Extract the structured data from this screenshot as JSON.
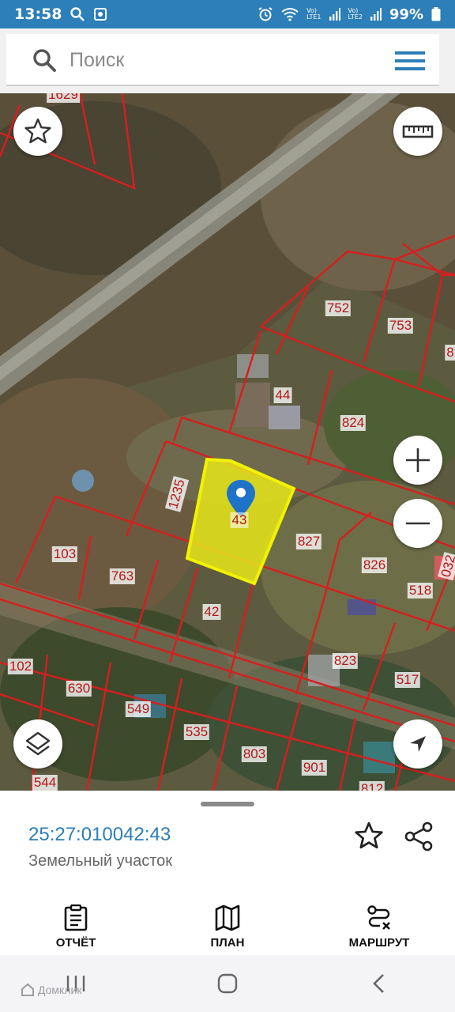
{
  "status_bar": {
    "time": "13:58",
    "network1": "Vo)\nLTE1",
    "network2": "Vo)\nLTE2",
    "battery": "99%"
  },
  "search": {
    "placeholder": "Поиск"
  },
  "map": {
    "parcels": [
      {
        "label": "1629"
      },
      {
        "label": "752"
      },
      {
        "label": "753"
      },
      {
        "label": "8"
      },
      {
        "label": "44"
      },
      {
        "label": "824"
      },
      {
        "label": "1235"
      },
      {
        "label": "43"
      },
      {
        "label": "827"
      },
      {
        "label": "103"
      },
      {
        "label": "763"
      },
      {
        "label": "826"
      },
      {
        "label": "518"
      },
      {
        "label": "42"
      },
      {
        "label": "102"
      },
      {
        "label": "823"
      },
      {
        "label": "630"
      },
      {
        "label": "517"
      },
      {
        "label": "549"
      },
      {
        "label": "535"
      },
      {
        "label": "803"
      },
      {
        "label": "901"
      },
      {
        "label": "544"
      },
      {
        "label": "812"
      },
      {
        "label": "032"
      }
    ],
    "selected_parcel": "43"
  },
  "colors": {
    "accent": "#2c7fb8",
    "parcel_border": "#d81e1e",
    "selected_fill": "#e8e81a"
  },
  "sheet": {
    "cadastral_number": "25:27:010042:43",
    "object_type": "Земельный участок"
  },
  "bottom_nav": {
    "report_label": "ОТЧЁТ",
    "plan_label": "ПЛАН",
    "route_label": "МАРШРУТ"
  },
  "watermark": "Домклик"
}
